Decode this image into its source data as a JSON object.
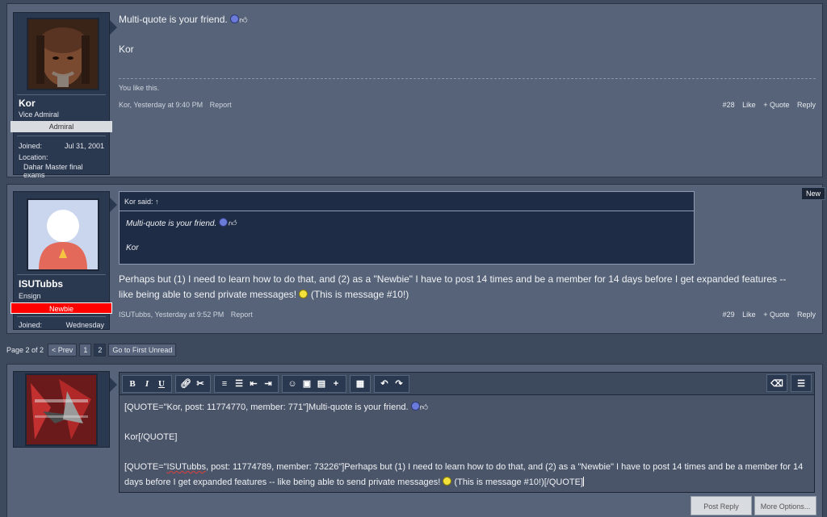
{
  "post1": {
    "username": "Kor",
    "user_title": "Vice Admiral",
    "banner": "Admiral",
    "joined_label": "Joined:",
    "joined_value": "Jul 31, 2001",
    "location_label": "Location:",
    "location_value": "Dahar Master final exams",
    "message": "Multi-quote is your friend.",
    "signature": "Kor",
    "likes_text": "You like this.",
    "meta_author_time": "Kor, Yesterday at 9:40 PM",
    "report": "Report",
    "number": "#28",
    "like": "Like",
    "quote": "+ Quote",
    "reply": "Reply"
  },
  "post2": {
    "username": "ISUTubbs",
    "user_title": "Ensign",
    "banner": "Newbie",
    "joined_label": "Joined:",
    "joined_value": "Wednesday",
    "new_tag": "New",
    "quote_header": "Kor said:",
    "quote_arrow": "↑",
    "quote_line1": "Multi-quote is your friend.",
    "quote_line2": "Kor",
    "message_part1": "Perhaps but (1) I need to learn how to do that, and (2) as a \"Newbie\" I have to post 14 times and be a member for 14 days before I get expanded features -- like being able to send private messages!",
    "message_part2": "(This is message #10!)",
    "meta_author_time": "ISUTubbs, Yesterday at 9:52 PM",
    "report": "Report",
    "number": "#29",
    "like": "Like",
    "quote": "+ Quote",
    "reply": "Reply"
  },
  "pagenav": {
    "label": "Page 2 of 2",
    "prev": "< Prev",
    "page1": "1",
    "page2": "2",
    "first_unread": "Go to First Unread"
  },
  "editor": {
    "line1": "[QUOTE=\"Kor, post: 11774770, member: 771\"]Multi-quote is your friend.",
    "line2": "Kor[/QUOTE]",
    "line3_pre": "[QUOTE=\"",
    "line3_name": "ISUTubbs",
    "line3_post": ", post: 11774789, member: 73226\"]Perhaps but (1) I need to learn how to do that, and (2) as a \"Newbie\" I have to post 14 times and be a member for 14 days before I get expanded features -- like being able to send private messages!",
    "line3_end": "(This is message #10!)[/QUOTE]",
    "toolbar_icons": [
      "bold-icon",
      "italic-icon",
      "underline-icon",
      "link-icon",
      "unlink-icon",
      "bullet-list-icon",
      "numbered-list-icon",
      "outdent-icon",
      "indent-icon",
      "smilie-icon",
      "image-icon",
      "media-icon",
      "insert-plus-icon",
      "save-draft-icon",
      "undo-icon",
      "redo-icon",
      "remove-formatting-icon",
      "toggle-bbcode-icon"
    ]
  },
  "buttons": {
    "post_reply": "Post Reply",
    "more_options": "More Options..."
  },
  "colors": {
    "page_bg": "#3d4a5e",
    "post_bg": "#566378",
    "userblock_bg": "#2a3850",
    "admiral_banner": "#d8dbe0",
    "newbie_banner": "#ff0000"
  }
}
